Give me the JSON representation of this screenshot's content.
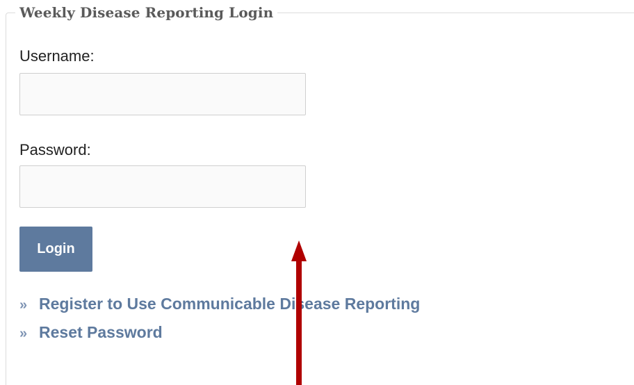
{
  "form": {
    "legend": "Weekly Disease Reporting Login",
    "username_label": "Username:",
    "username_value": "",
    "password_label": "Password:",
    "password_value": "",
    "login_label": "Login"
  },
  "links": {
    "bullet": "»",
    "register": "Register to Use Communicable Disease Reporting",
    "reset": "Reset Password"
  },
  "annotation": {
    "arrow_color": "#b00000",
    "arrow_direction": "up"
  },
  "colors": {
    "accent": "#5e7a9e",
    "legend_text": "#5a5a5a"
  }
}
